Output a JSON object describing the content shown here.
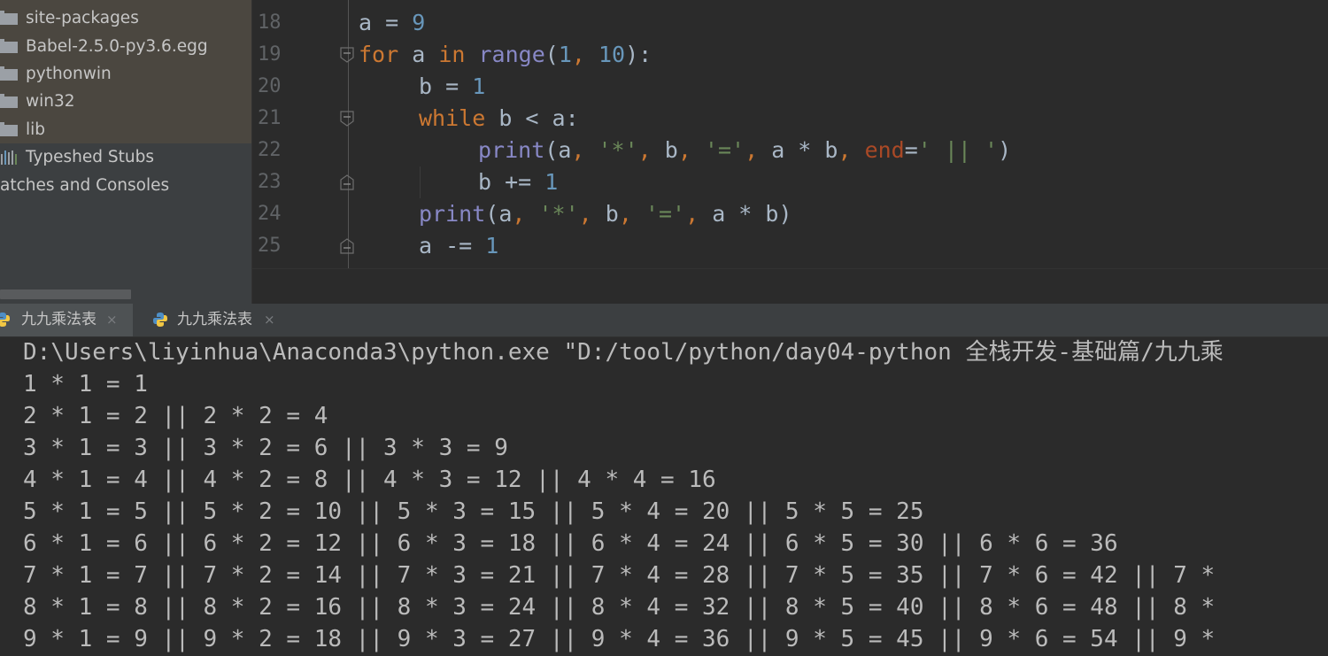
{
  "project_tree": {
    "items": [
      {
        "label": "site-packages",
        "icon": "folder-icon"
      },
      {
        "label": "Babel-2.5.0-py3.6.egg",
        "icon": "folder-icon"
      },
      {
        "label": "pythonwin",
        "icon": "folder-icon"
      },
      {
        "label": "win32",
        "icon": "folder-icon"
      },
      {
        "label": "lib",
        "icon": "folder-icon"
      },
      {
        "label": "Typeshed Stubs",
        "icon": "library-icon"
      },
      {
        "label": "atches and Consoles",
        "icon": ""
      }
    ]
  },
  "editor": {
    "line_numbers": [
      "18",
      "19",
      "20",
      "21",
      "22",
      "23",
      "24",
      "25"
    ],
    "code": {
      "l18": {
        "var": "a",
        "op": " = ",
        "num": "9"
      },
      "l19": {
        "kw_for": "for",
        "var": " a ",
        "kw_in": "in",
        "sp": " ",
        "fn": "range",
        "open": "(",
        "n1": "1",
        "comma": ", ",
        "n2": "10",
        "close": "):"
      },
      "l20": {
        "var": "b",
        "op": " = ",
        "num": "1"
      },
      "l21": {
        "kw": "while",
        "rest": " b < a:"
      },
      "l22": {
        "fn": "print",
        "a": "(a",
        "c1": ", ",
        "s1": "'*'",
        "c2": ", ",
        "b": "b",
        "c3": ", ",
        "s2": "'='",
        "c4": ", ",
        "expr": "a * b",
        "c5": ", ",
        "param": "end",
        "eq": "=",
        "s3": "' || '",
        "close": ")"
      },
      "l23": {
        "var": "b",
        "op": " += ",
        "num": "1"
      },
      "l24": {
        "fn": "print",
        "a": "(a",
        "c1": ", ",
        "s1": "'*'",
        "c2": ", ",
        "b": "b",
        "c3": ", ",
        "s2": "'='",
        "c4": ", ",
        "expr": "a * b)"
      },
      "l25": {
        "var": "a",
        "op": " -= ",
        "num": "1"
      }
    }
  },
  "run_tabs": [
    {
      "label": "九九乘法表",
      "close": "×",
      "icon": "python-icon",
      "active": true
    },
    {
      "label": "九九乘法表",
      "close": "×",
      "icon": "python-icon",
      "active": false
    }
  ],
  "console": {
    "lines": [
      "D:\\Users\\liyinhua\\Anaconda3\\python.exe \"D:/tool/python/day04-python 全栈开发-基础篇/九九乘",
      "1 * 1 = 1",
      "2 * 1 = 2 || 2 * 2 = 4",
      "3 * 1 = 3 || 3 * 2 = 6 || 3 * 3 = 9",
      "4 * 1 = 4 || 4 * 2 = 8 || 4 * 3 = 12 || 4 * 4 = 16",
      "5 * 1 = 5 || 5 * 2 = 10 || 5 * 3 = 15 || 5 * 4 = 20 || 5 * 5 = 25",
      "6 * 1 = 6 || 6 * 2 = 12 || 6 * 3 = 18 || 6 * 4 = 24 || 6 * 5 = 30 || 6 * 6 = 36",
      "7 * 1 = 7 || 7 * 2 = 14 || 7 * 3 = 21 || 7 * 4 = 28 || 7 * 5 = 35 || 7 * 6 = 42 || 7 *",
      "8 * 1 = 8 || 8 * 2 = 16 || 8 * 3 = 24 || 8 * 4 = 32 || 8 * 5 = 40 || 8 * 6 = 48 || 8 *",
      "9 * 1 = 9 || 9 * 2 = 18 || 9 * 3 = 27 || 9 * 4 = 36 || 9 * 5 = 45 || 9 * 6 = 54 || 9 *"
    ]
  },
  "colors": {
    "editor_bg": "#2b2b2b",
    "sidebar_bg": "#3c3f41",
    "keyword": "#cc7832",
    "number": "#6897bb",
    "string": "#6a8759",
    "builtin": "#8888c6",
    "param": "#aa4926",
    "text": "#a9b7c6"
  }
}
